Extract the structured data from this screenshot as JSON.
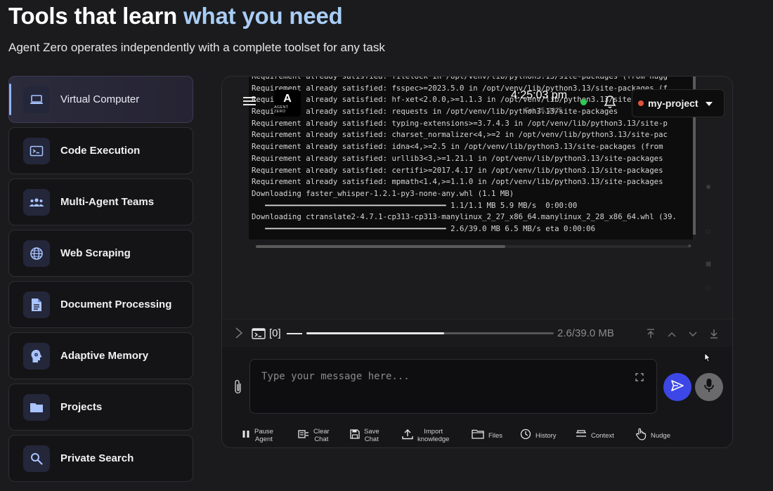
{
  "hero": {
    "title_main": "Tools that learn ",
    "title_accent": "what you need",
    "subtitle": "Agent Zero operates independently with a complete toolset for any task"
  },
  "features": [
    {
      "label": "Virtual Computer",
      "icon": "laptop-icon",
      "active": true
    },
    {
      "label": "Code Execution",
      "icon": "terminal-icon",
      "active": false
    },
    {
      "label": "Multi-Agent Teams",
      "icon": "group-icon",
      "active": false
    },
    {
      "label": "Web Scraping",
      "icon": "globe-icon",
      "active": false
    },
    {
      "label": "Document Processing",
      "icon": "document-icon",
      "active": false
    },
    {
      "label": "Adaptive Memory",
      "icon": "brain-icon",
      "active": false
    },
    {
      "label": "Projects",
      "icon": "folder-icon",
      "active": false
    },
    {
      "label": "Private Search",
      "icon": "search-icon",
      "active": false
    }
  ],
  "terminal": {
    "lines": [
      "Requirement already satisfied: filelock in /opt/venv/lib/python3.13/site-packages (from hugg",
      "Requirement already satisfied: fsspec>=2023.5.0 in /opt/venv/lib/python3.13/site-packages (f",
      "Requirement already satisfied: hf-xet<2.0.0,>=1.1.3 in /opt/venv/lib/python3.13/site-package",
      "Requirement already satisfied: requests in /opt/venv/lib/python3.13/site-packages",
      "Requirement already satisfied: typing-extensions>=3.7.4.3 in /opt/venv/lib/python3.13/site-p",
      "Requirement already satisfied: charset_normalizer<4,>=2 in /opt/venv/lib/python3.13/site-pac",
      "Requirement already satisfied: idna<4,>=2.5 in /opt/venv/lib/python3.13/site-packages (from",
      "Requirement already satisfied: urllib3<3,>=1.21.1 in /opt/venv/lib/python3.13/site-packages",
      "Requirement already satisfied: certifi>=2017.4.17 in /opt/venv/lib/python3.13/site-packages",
      "Requirement already satisfied: mpmath<1.4,>=1.1.0 in /opt/venv/lib/python3.13/site-packages",
      "Downloading faster_whisper-1.2.1-py3-none-any.whl (1.1 MB)",
      "   ━━━━━━━━━━━━━━━━━━━━━━━━━━━━━━━━━━━━━━━━ 1.1/1.1 MB 5.9 MB/s  0:00:00",
      "Downloading ctranslate2-4.7.1-cp313-cp313-manylinux_2_27_x86_64.manylinux_2_28_x86_64.whl (39.",
      "   ━━━━━━━━━━━━━━━━━━━━━━━━━━━━━━━━━━━━━━━━ 2.6/39.0 MB 6.5 MB/s eta 0:00:06"
    ]
  },
  "overlay": {
    "logo_mark": "A",
    "logo_text": "AGENT ZERO",
    "time": "4:25:03 pm",
    "date": "Feb 25, 2025",
    "project": "my-project",
    "colors": {
      "online": "#2ecc55",
      "project_dot": "#e0533b"
    }
  },
  "progress": {
    "index": "[0]",
    "size": "2.6/39.0 MB",
    "fraction": 0.556
  },
  "chat": {
    "placeholder": "Type your message here..."
  },
  "actions": [
    {
      "label": "Pause\nAgent",
      "icon": "pause-icon"
    },
    {
      "label": "Clear\nChat",
      "icon": "clear-chat-icon"
    },
    {
      "label": "Save\nChat",
      "icon": "save-icon"
    },
    {
      "label": "Import\nknowledge",
      "icon": "upload-icon"
    },
    {
      "label": "Files",
      "icon": "folder-icon"
    },
    {
      "label": "History",
      "icon": "history-icon"
    },
    {
      "label": "Context",
      "icon": "context-icon"
    },
    {
      "label": "Nudge",
      "icon": "hand-icon"
    }
  ],
  "colors": {
    "accent": "#a9cdf5",
    "send": "#3d47e6",
    "mic": "#6a6a6c",
    "background": "#1b1b1d"
  }
}
